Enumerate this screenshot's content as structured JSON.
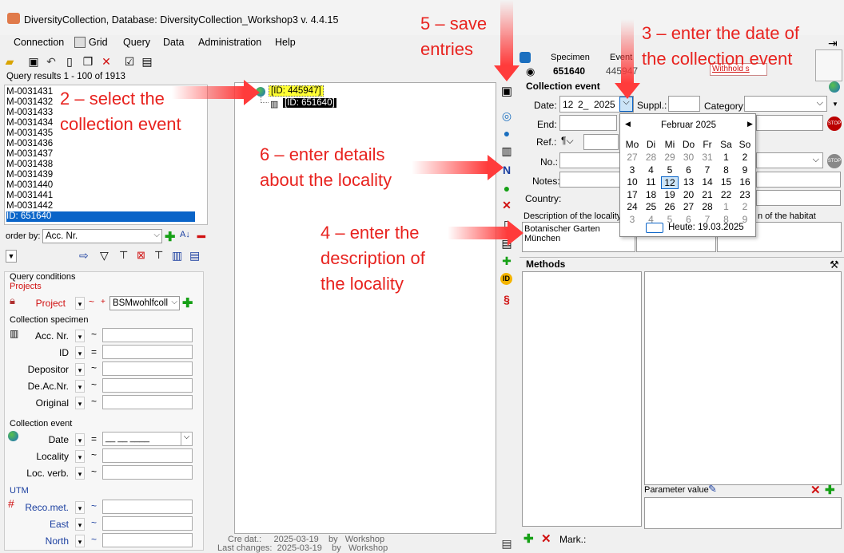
{
  "window": {
    "title": "DiversityCollection,  Database: DiversityCollection_Workshop3    v. 4.4.15"
  },
  "menu": {
    "connection": "Connection",
    "grid": "Grid",
    "query": "Query",
    "data": "Data",
    "administration": "Administration",
    "help": "Help"
  },
  "query_results": "Query results   1 - 100 of 1913",
  "list_items": [
    "M-0031431",
    "M-0031432",
    "M-0031433",
    "M-0031434",
    "M-0031435",
    "M-0031436",
    "M-0031437",
    "M-0031438",
    "M-0031439",
    "M-0031440",
    "M-0031441",
    "M-0031442",
    "ID: 651640"
  ],
  "orderby": {
    "label": "order by:",
    "value": "Acc. Nr."
  },
  "query_conditions": {
    "title": "Query conditions",
    "projects": "Projects",
    "project_label": "Project",
    "project_value": "BSMwohlfcoll",
    "collection_specimen": "Collection specimen",
    "acc_nr": "Acc. Nr.",
    "id": "ID",
    "depositor": "Depositor",
    "de_ac_nr": "De.Ac.Nr.",
    "original": "Original",
    "collection_event": "Collection event",
    "date": "Date",
    "locality": "Locality",
    "loc_verb": "Loc. verb.",
    "utm": "UTM",
    "reco_met": "Reco.met.",
    "east": "East",
    "north": "North",
    "op_tilde": "~",
    "op_eq": "=",
    "date_placeholder": "__  __   ____"
  },
  "tree": {
    "event_node": "[ID: 445947]",
    "specimen_node": "[ID: 651640]"
  },
  "footer": {
    "cre_dat_label": "Cre dat.:",
    "cre_dat": "2025-03-19",
    "by": "by",
    "user": "Workshop",
    "last_changes_label": "Last changes:",
    "last_changes": "2025-03-19"
  },
  "header": {
    "specimen": "Specimen",
    "event": "Event",
    "specimen_id": "651640",
    "event_id": "445947",
    "withhold": "Withhold s"
  },
  "event": {
    "title": "Collection event",
    "date_label": "Date:",
    "day": "12",
    "month": "2_",
    "year": "2025",
    "suppl_label": "Suppl.:",
    "category_label": "Category:",
    "end_label": "End:",
    "ref_label": "Ref.:",
    "no_label": "No.:",
    "notes_label": "Notes:",
    "country_label": "Country:",
    "desc_loc_label": "Description of the locality",
    "habitat_label": "n of the habitat",
    "locality_text": "Botanischer Garten\nMünchen"
  },
  "calendar": {
    "month": "Februar 2025",
    "weekdays": [
      "Mo",
      "Di",
      "Mi",
      "Do",
      "Fr",
      "Sa",
      "So"
    ],
    "weeks": [
      [
        "27",
        "28",
        "29",
        "30",
        "31",
        "1",
        "2"
      ],
      [
        "3",
        "4",
        "5",
        "6",
        "7",
        "8",
        "9"
      ],
      [
        "10",
        "11",
        "12",
        "13",
        "14",
        "15",
        "16"
      ],
      [
        "17",
        "18",
        "19",
        "20",
        "21",
        "22",
        "23"
      ],
      [
        "24",
        "25",
        "26",
        "27",
        "28",
        "1",
        "2"
      ],
      [
        "3",
        "4",
        "5",
        "6",
        "7",
        "8",
        "9"
      ]
    ],
    "today": "Heute: 19.03.2025",
    "selected": "12"
  },
  "methods": {
    "title": "Methods",
    "param_value": "Parameter value",
    "mark": "Mark.:"
  },
  "annotations": {
    "a2": "2 – select the\ncollection event",
    "a3": "3 – enter the date of\nthe collection event",
    "a4": "4 – enter the\ndescription of\nthe locality",
    "a5": "5 – save\nentries",
    "a6": "6 – enter details\nabout the locality"
  },
  "colors": {
    "annotation": "#e8231f",
    "arrow": "#ff3b3b",
    "selection": "#0a64c8",
    "highlight": "#ffff33"
  }
}
